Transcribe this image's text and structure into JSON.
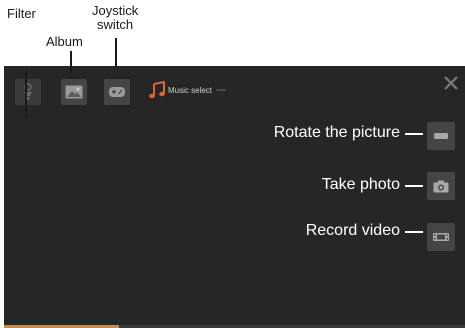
{
  "callouts": {
    "filter": "Filter",
    "album": "Album",
    "joystick_line1": "Joystick",
    "joystick_line2": "switch"
  },
  "toolbar": {
    "music_label": "Music select"
  },
  "side_controls": {
    "rotate": "Rotate the picture",
    "photo": "Take photo",
    "video": "Record video"
  },
  "progress": {
    "fraction": 0.25
  },
  "colors": {
    "screen_bg": "#262626",
    "tile_bg": "#454545",
    "accent": "#d98a2a",
    "music_icon": "#e0652d"
  },
  "icons": [
    "filter-icon",
    "album-icon",
    "joystick-icon",
    "music-note-icon",
    "close-icon",
    "rotate-icon",
    "camera-icon",
    "video-icon"
  ]
}
